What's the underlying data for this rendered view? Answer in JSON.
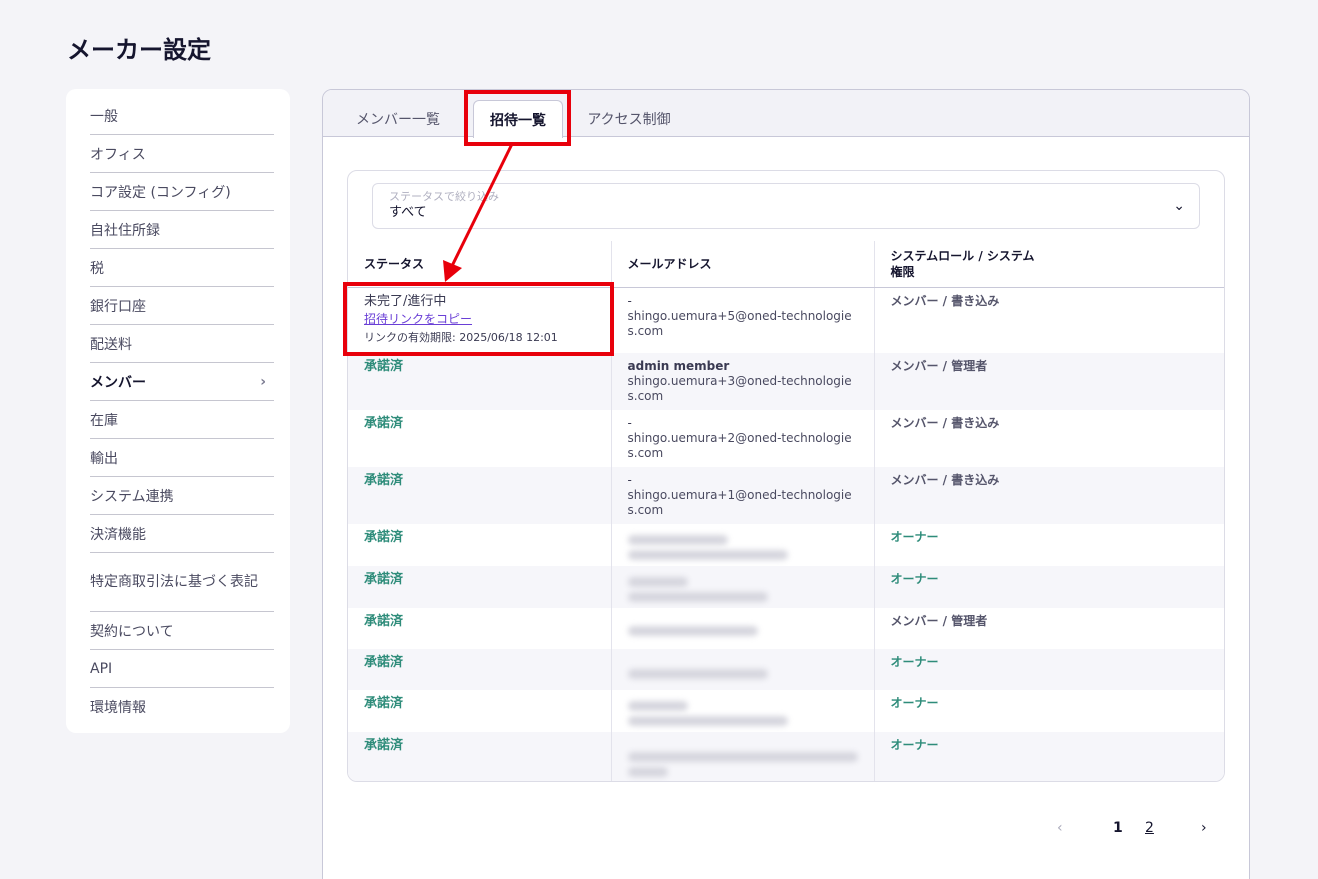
{
  "page_title": "メーカー設定",
  "sidebar": {
    "items": [
      {
        "label": "一般"
      },
      {
        "label": "オフィス"
      },
      {
        "label": "コア設定 (コンフィグ)"
      },
      {
        "label": "自社住所録"
      },
      {
        "label": "税"
      },
      {
        "label": "銀行口座"
      },
      {
        "label": "配送料"
      },
      {
        "label": "メンバー",
        "active": true,
        "chevron": "›"
      },
      {
        "label": "在庫"
      },
      {
        "label": "輸出"
      },
      {
        "label": "システム連携"
      },
      {
        "label": "決済機能"
      },
      {
        "label": "特定商取引法に基づく表記"
      },
      {
        "label": "契約について"
      },
      {
        "label": "API"
      },
      {
        "label": "環境情報"
      }
    ]
  },
  "tabs": [
    {
      "label": "メンバー一覧"
    },
    {
      "label": "招待一覧",
      "active": true
    },
    {
      "label": "アクセス制御"
    }
  ],
  "filter": {
    "placeholder": "ステータスで絞り込み",
    "value": "すべて",
    "chevron": "⌄"
  },
  "table": {
    "headers": [
      "ステータス",
      "メールアドレス",
      "システムロール / システム権限"
    ],
    "pending_row": {
      "status": "未完了/進行中",
      "copy_link": "招待リンクをコピー",
      "expiry": "リンクの有効期限: 2025/06/18 12:01",
      "name": "-",
      "email": "shingo.uemura+5@oned-technologies.com",
      "role": "メンバー / 書き込み"
    },
    "rows": [
      {
        "status": "承諾済",
        "name": "admin member",
        "email": "shingo.uemura+3@oned-technologies.com",
        "role": "メンバー / 管理者"
      },
      {
        "status": "承諾済",
        "name": "-",
        "email": "shingo.uemura+2@oned-technologies.com",
        "role": "メンバー / 書き込み"
      },
      {
        "status": "承諾済",
        "name": "-",
        "email": "shingo.uemura+1@oned-technologies.com",
        "role": "メンバー / 書き込み"
      }
    ],
    "blurred_rows": [
      {
        "status": "承諾済",
        "role": "オーナー"
      },
      {
        "status": "承諾済",
        "role": "オーナー"
      },
      {
        "status": "承諾済",
        "role": "メンバー / 管理者"
      },
      {
        "status": "承諾済",
        "role": "オーナー"
      },
      {
        "status": "承諾済",
        "role": "オーナー"
      },
      {
        "status": "承諾済",
        "role": "オーナー"
      }
    ]
  },
  "pagination": {
    "prev": "‹",
    "page1": "1",
    "page2": "2",
    "next": "›"
  },
  "colors": {
    "accent_red": "#e8000b",
    "status_green": "#2e8c7a",
    "link_purple": "#6a3fd6"
  }
}
